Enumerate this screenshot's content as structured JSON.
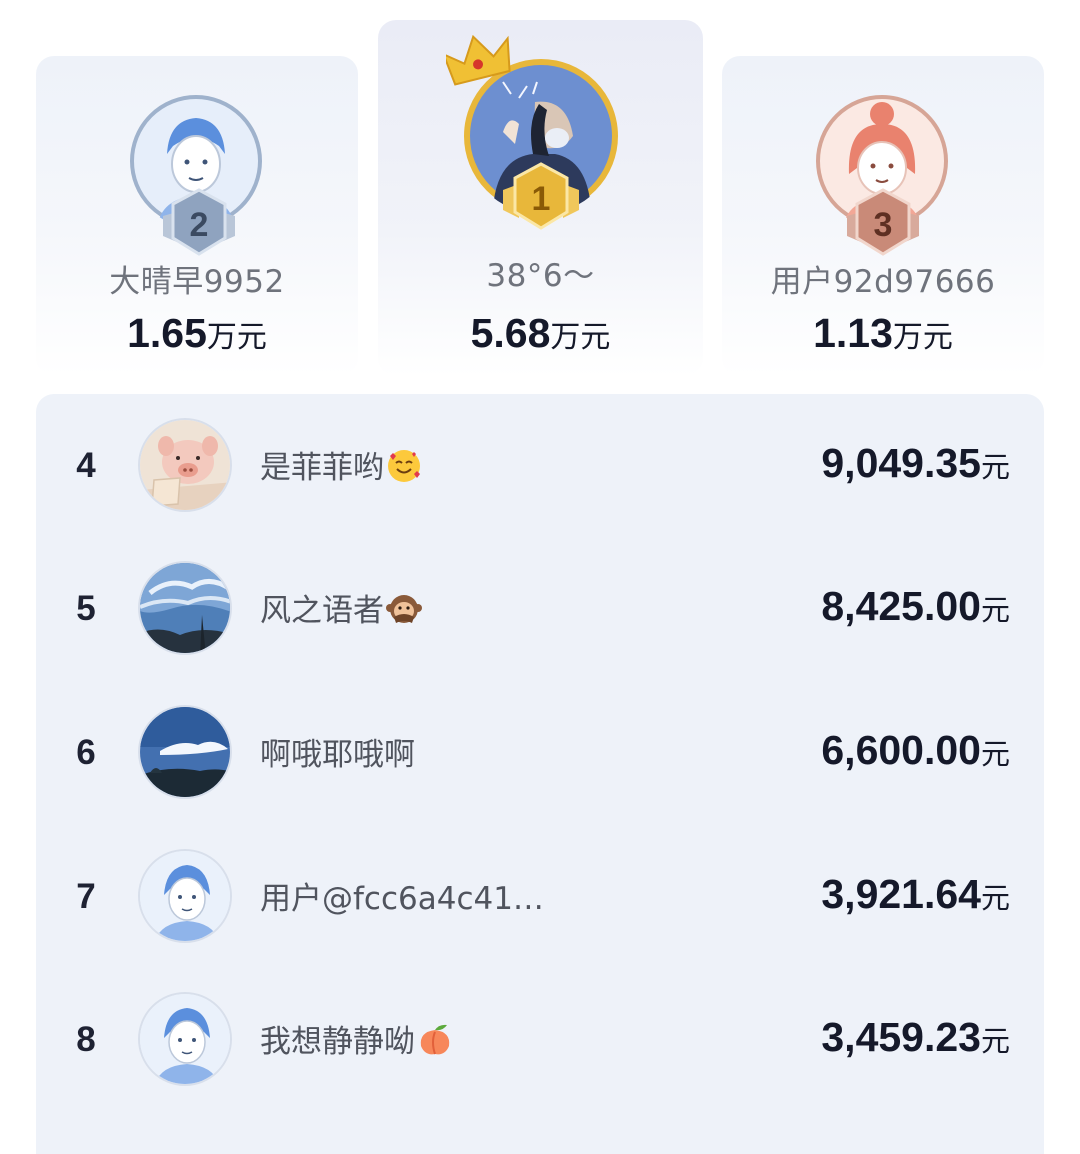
{
  "podium": [
    {
      "rank": "2",
      "name": "大晴早9952",
      "amount": "1.65",
      "unit": "万元"
    },
    {
      "rank": "1",
      "name": "38°6～",
      "amount": "5.68",
      "unit": "万元"
    },
    {
      "rank": "3",
      "name": "用户92d97666",
      "amount": "1.13",
      "unit": "万元"
    }
  ],
  "list": [
    {
      "rank": "4",
      "name": "是菲菲哟",
      "amount": "9,049.35",
      "unit": "元",
      "emoji": "smiling-face-with-hearts"
    },
    {
      "rank": "5",
      "name": "风之语者",
      "amount": "8,425.00",
      "unit": "元",
      "emoji": "speak-no-evil-monkey"
    },
    {
      "rank": "6",
      "name": "啊哦耶哦啊",
      "amount": "6,600.00",
      "unit": "元"
    },
    {
      "rank": "7",
      "name": "用户@fcc6a4c41…",
      "amount": "3,921.64",
      "unit": "元"
    },
    {
      "rank": "8",
      "name": "我想静静呦",
      "amount": "3,459.23",
      "unit": "元",
      "emoji": "peach"
    }
  ],
  "colors": {
    "gold": "#e8b73a",
    "silver": "#8fa3bf",
    "bronze": "#c98a78",
    "accent": "#15192a"
  }
}
